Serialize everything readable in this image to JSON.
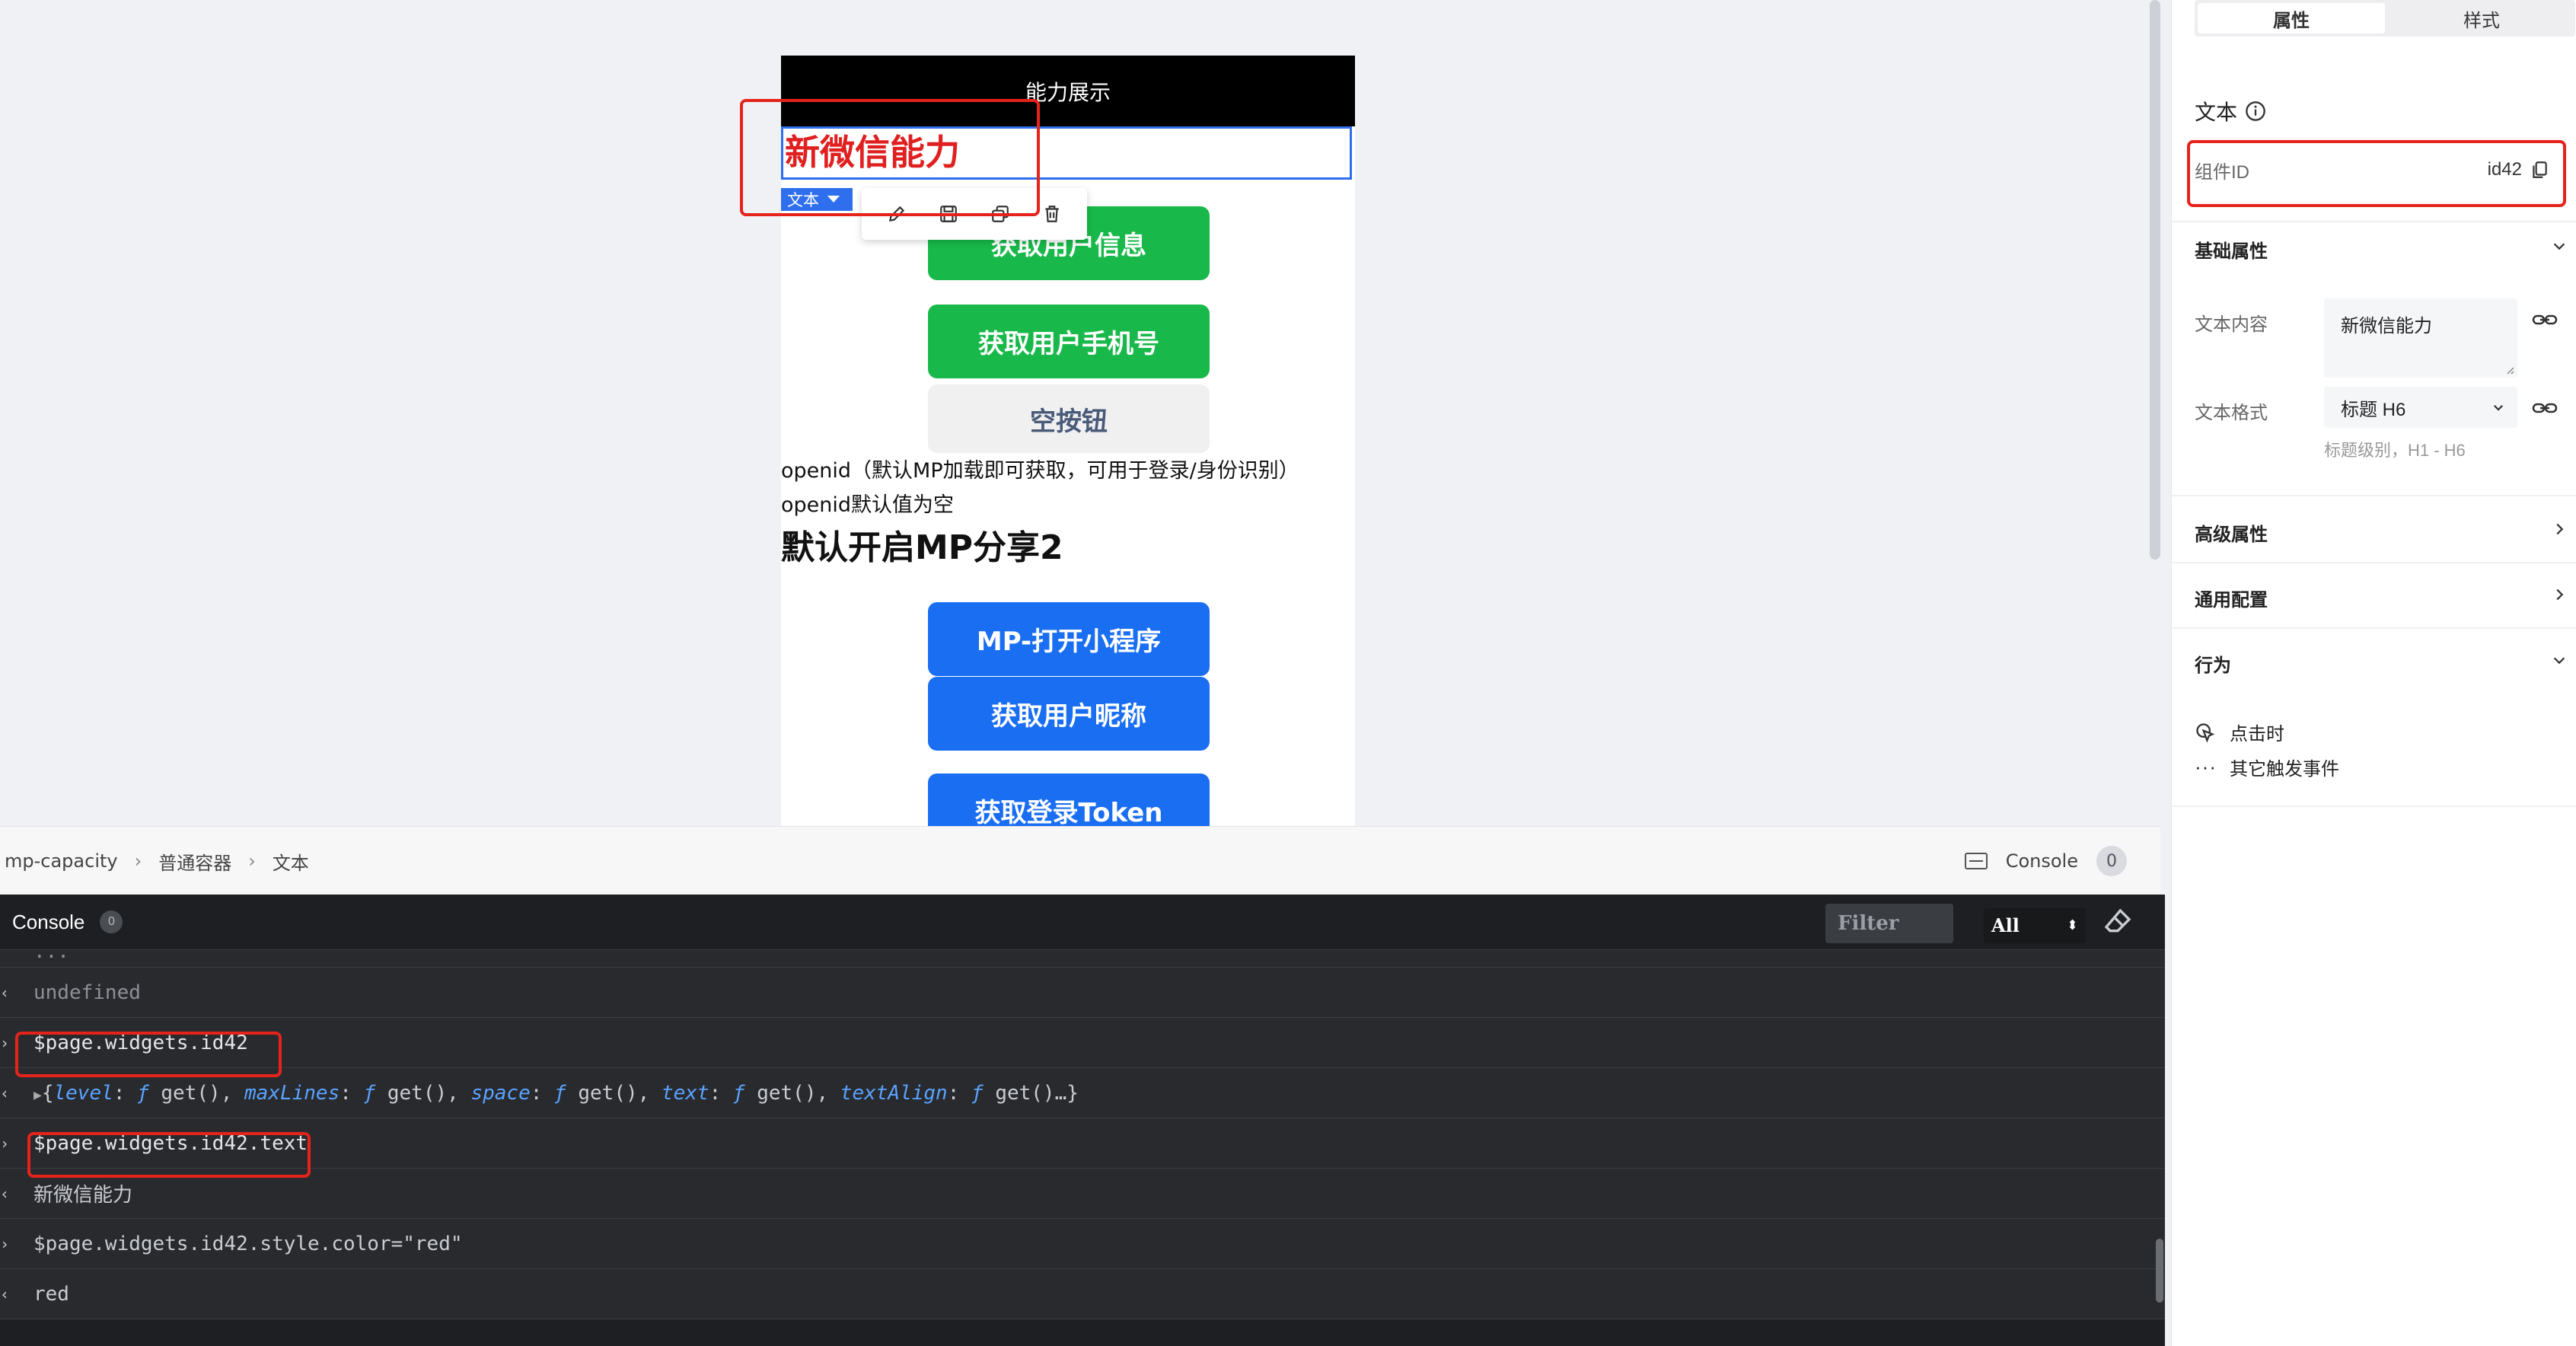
{
  "phone": {
    "header_title": "能力展示",
    "selected_text": "新微信能力",
    "buttons": {
      "get_user_info": "获取用户信息",
      "get_phone": "获取用户手机号",
      "empty": "空按钮",
      "open_mp": "MP-打开小程序",
      "get_nickname": "获取用户昵称",
      "get_token": "获取登录Token"
    },
    "openid_line": "openid（默认MP加载即可获取，可用于登录/身份识别）",
    "openid_default": "openid默认值为空",
    "share_heading": "默认开启MP分享2"
  },
  "component_tag": {
    "label": "文本"
  },
  "breadcrumb": {
    "items": [
      "mp-capacity",
      "普通容器",
      "文本"
    ]
  },
  "console_toggle": {
    "label": "Console",
    "count": "0"
  },
  "console": {
    "title": "Console",
    "count": "0",
    "filter_placeholder": "Filter",
    "level": "All",
    "rows": {
      "r0": "...",
      "r1": "undefined",
      "r2": "$page.widgets.id42",
      "r3_props": [
        "level",
        "maxLines",
        "space",
        "text",
        "textAlign"
      ],
      "r3_fn": "ƒ",
      "r3_get": "get()",
      "r3_open": "{",
      "r3_tail": "…}",
      "r4": "$page.widgets.id42.text",
      "r5": "新微信能力",
      "r6": "$page.widgets.id42.style.color=\"red\"",
      "r7": "red"
    }
  },
  "panel": {
    "tabs": [
      "属性",
      "样式"
    ],
    "component_type": "文本",
    "component_id_label": "组件ID",
    "component_id_value": "id42",
    "basic_section": "基础属性",
    "text_content_label": "文本内容",
    "text_content_value": "新微信能力",
    "text_format_label": "文本格式",
    "text_format_value": "标题 H6",
    "text_format_hint": "标题级别，H1 - H6",
    "advanced_section": "高级属性",
    "general_section": "通用配置",
    "behavior_section": "行为",
    "on_click": "点击时",
    "other_events": "其它触发事件"
  },
  "colors": {
    "accent": "#2f6fed",
    "annotation": "#e5231b",
    "green": "#18b94a",
    "blue": "#1a6ef2"
  }
}
